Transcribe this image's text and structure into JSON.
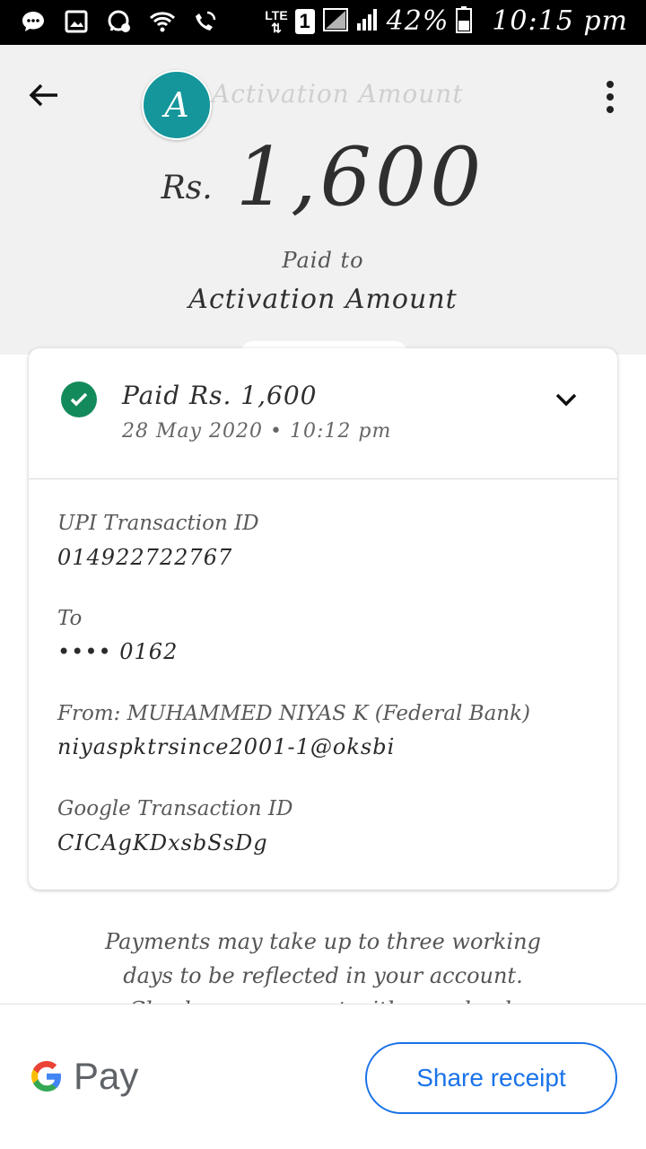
{
  "status_bar": {
    "network": "LTE",
    "sim": "1",
    "battery": "42%",
    "time": "10:15 pm",
    "icons": [
      "chat-bubble-icon",
      "image-icon",
      "whatsapp-icon",
      "wifi-icon",
      "wifi-calling-icon"
    ]
  },
  "header": {
    "avatar_letter": "A",
    "title": "Activation Amount",
    "currency": "Rs.",
    "amount": "1,600",
    "paid_to_label": "Paid to",
    "payee": "Activation Amount"
  },
  "card": {
    "status_text": "Paid Rs. 1,600",
    "datetime": "28 May 2020 • 10:12 pm",
    "upi_label": "UPI Transaction ID",
    "upi_value": "014922722767",
    "to_label": "To",
    "to_value": "•••• 0162",
    "from_label": "From: MUHAMMED NIYAS K (Federal Bank)",
    "from_value": "niyaspktrsince2001-1@oksbi",
    "google_label": "Google Transaction ID",
    "google_value": "CICAgKDxsbSsDg"
  },
  "note": {
    "line1": "Payments may take up to three working",
    "line2": "days to be reflected in your account.",
    "line3": "Check your account with your bank"
  },
  "footer": {
    "brand": "Pay",
    "share_label": "Share receipt"
  },
  "colors": {
    "avatar": "#14969b",
    "success": "#138a5a",
    "accent": "#1a73e8",
    "header_bg": "#f1f1f1"
  }
}
